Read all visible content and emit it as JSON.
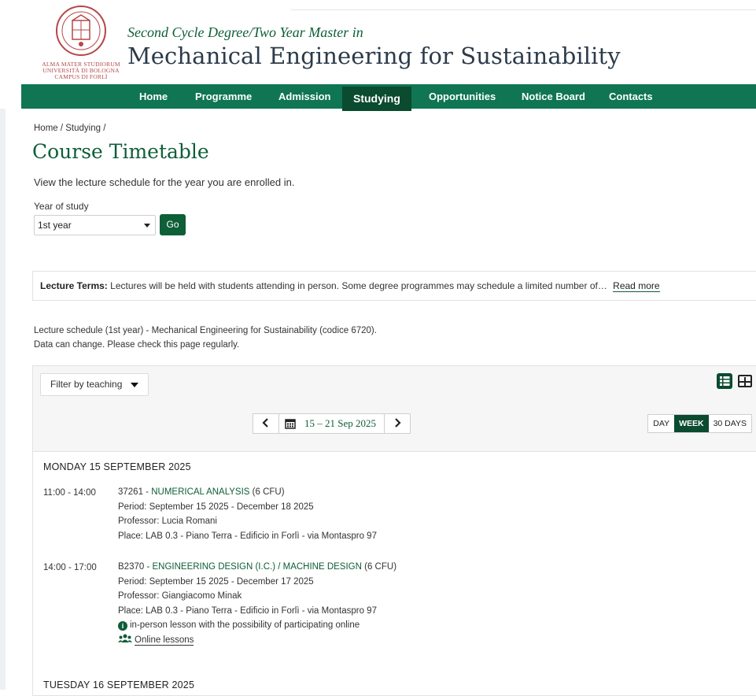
{
  "logo": {
    "lines": [
      "ALMA MATER STUDIORUM",
      "UNIVERSITÀ DI BOLOGNA",
      "CAMPUS DI FORLÌ"
    ]
  },
  "header": {
    "subtitle": "Second Cycle Degree/Two Year Master in",
    "title": "Mechanical Engineering for Sustainability"
  },
  "nav": {
    "items": [
      {
        "label": "Home"
      },
      {
        "label": "Programme"
      },
      {
        "label": "Admission"
      },
      {
        "label": "Studying",
        "active": true
      },
      {
        "label": "Opportunities"
      },
      {
        "label": "Notice Board"
      },
      {
        "label": "Contacts"
      }
    ]
  },
  "breadcrumb": "Home / Studying /",
  "page": {
    "title": "Course Timetable",
    "intro": "View the lecture schedule for the year you are enrolled in."
  },
  "year_select": {
    "label": "Year of study",
    "value": "1st year",
    "go_label": "Go"
  },
  "terms": {
    "label": "Lecture Terms:",
    "text": "Lectures  will be held with students attending in person. Some degree programmes may schedule a limited number of…",
    "read_more": "Read more"
  },
  "schedule_info": {
    "line1": "Lecture schedule (1st year) - Mechanical Engineering for Sustainability (codice 6720).",
    "line2": "Data can change. Please check this page regularly."
  },
  "toolbar": {
    "filter_label": "Filter by teaching",
    "date_range": "15 – 21 Sep 2025",
    "modes": [
      "DAY",
      "WEEK",
      "30 DAYS"
    ],
    "active_mode": "WEEK"
  },
  "days": [
    {
      "heading": "MONDAY 15 SEPTEMBER 2025",
      "lessons": [
        {
          "time": "11:00 - 14:00",
          "code": "37261 - ",
          "name": "NUMERICAL ANALYSIS",
          "cfu": " (6 CFU)",
          "period": "Period: September 15 2025 - December 18 2025",
          "professor": "Professor: Lucia Romani",
          "place": "Place: LAB 0.3 - Piano Terra - Edificio in Forlì - via Montaspro 97"
        },
        {
          "time": "14:00 - 17:00",
          "code": "B2370 - ",
          "name": "ENGINEERING DESIGN (I.C.) / MACHINE DESIGN",
          "cfu": " (6 CFU)",
          "period": "Period: September 15 2025 - December 17 2025",
          "professor": "Professor: Giangiacomo Minak",
          "place": "Place: LAB 0.3 - Piano Terra - Edificio in Forlì - via Montaspro 97",
          "note": "in-person lesson with the possibility of participating online",
          "online_link": "Online lessons"
        }
      ]
    },
    {
      "heading": "TUESDAY 16 SEPTEMBER 2025",
      "lessons": []
    }
  ],
  "colors": {
    "brand_green": "#0f7552",
    "dark_green": "#0b4b30",
    "link_green": "#0e5e38",
    "seal_red": "#b5474a"
  }
}
